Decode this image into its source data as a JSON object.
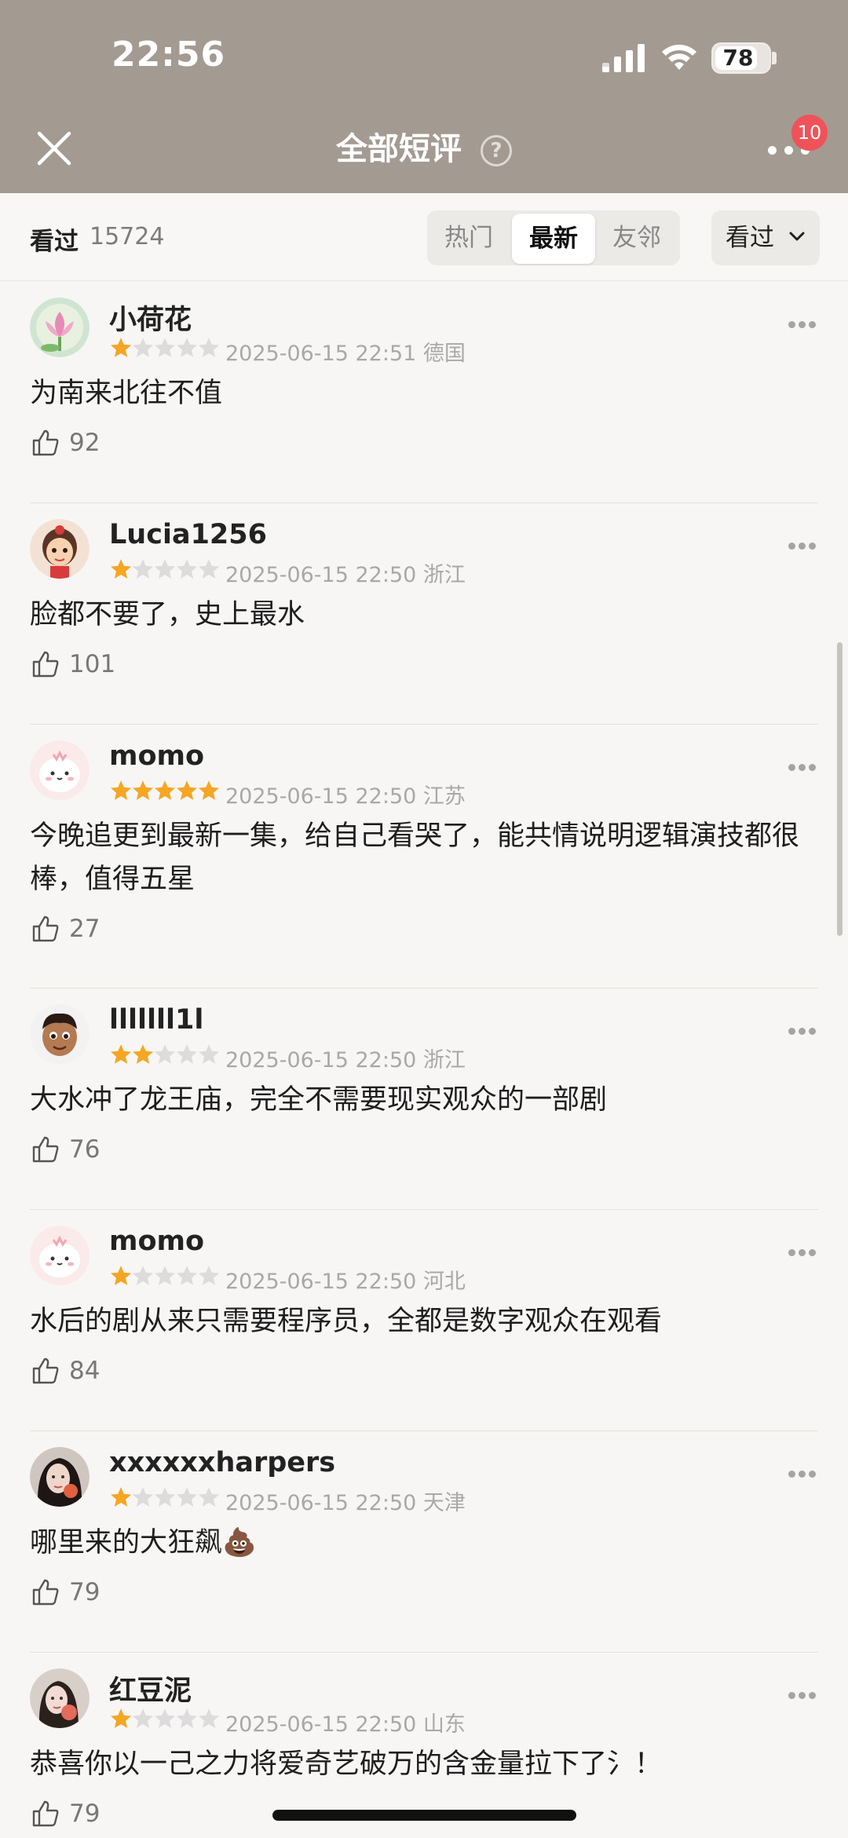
{
  "status_bar": {
    "time": "22:56",
    "battery": "78",
    "battery_level": 0.78
  },
  "nav": {
    "title": "全部短评",
    "help_icon": "question-circle-icon",
    "badge": "10"
  },
  "filter": {
    "seen_label": "看过",
    "seen_count": "15724",
    "tabs": [
      {
        "label": "热门",
        "active": false
      },
      {
        "label": "最新",
        "active": true
      },
      {
        "label": "友邻",
        "active": false
      }
    ],
    "dropdown_label": "看过"
  },
  "colors": {
    "header_bg": "#a39a92",
    "star_on": "#f5a623",
    "star_off": "#dcdcdc",
    "badge": "#f0525a"
  },
  "reviews": [
    {
      "user": "小荷花",
      "rating": 1,
      "date": "2025-06-15 22:51",
      "location": "德国",
      "text": "为南来北往不值",
      "likes": "92",
      "avatar": "lotus"
    },
    {
      "user": "Lucia1256",
      "rating": 1,
      "date": "2025-06-15 22:50",
      "location": "浙江",
      "text": "脸都不要了，史上最水",
      "likes": "101",
      "avatar": "cartoon-girl"
    },
    {
      "user": "momo",
      "rating": 5,
      "date": "2025-06-15 22:50",
      "location": "江苏",
      "text": "今晚追更到最新一集，给自己看哭了，能共情说明逻辑演技都很棒，值得五星",
      "likes": "27",
      "avatar": "pink-blob"
    },
    {
      "user": "lllllll1l",
      "rating": 2,
      "date": "2025-06-15 22:50",
      "location": "浙江",
      "text": "大水冲了龙王庙，完全不需要现实观众的一部剧",
      "likes": "76",
      "avatar": "cartoon-boy"
    },
    {
      "user": "momo",
      "rating": 1,
      "date": "2025-06-15 22:50",
      "location": "河北",
      "text": "水后的剧从来只需要程序员，全都是数字观众在观看",
      "likes": "84",
      "avatar": "pink-blob"
    },
    {
      "user": "xxxxxxharpers",
      "rating": 1,
      "date": "2025-06-15 22:50",
      "location": "天津",
      "text": "哪里来的大狂飙💩",
      "likes": "79",
      "avatar": "photo-girl"
    },
    {
      "user": "红豆泥",
      "rating": 1,
      "date": "2025-06-15 22:50",
      "location": "山东",
      "text": "恭喜你以一己之力将爱奇艺破万的含金量拉下了氵！",
      "likes": "79",
      "avatar": "photo-girl-2"
    }
  ]
}
